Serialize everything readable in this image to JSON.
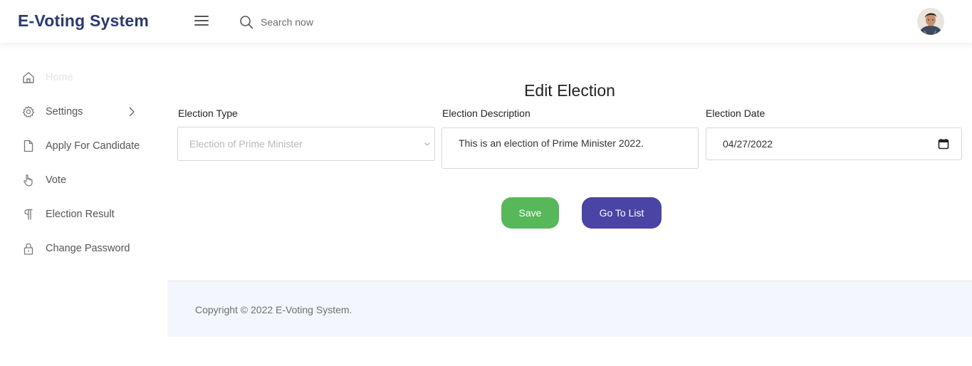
{
  "header": {
    "brand": "E-Voting System",
    "search_placeholder": "Search now"
  },
  "sidebar": {
    "items": [
      {
        "label": "Home",
        "icon": "home-icon"
      },
      {
        "label": "Settings",
        "icon": "gear-icon"
      },
      {
        "label": "Apply For Candidate",
        "icon": "file-icon"
      },
      {
        "label": "Vote",
        "icon": "hand-pointer-icon"
      },
      {
        "label": "Election Result",
        "icon": "paragraph-icon"
      },
      {
        "label": "Change Password",
        "icon": "lock-icon"
      }
    ]
  },
  "form": {
    "title": "Edit Election",
    "election_type_label": "Election Type",
    "election_type_value": "Election of Prime Minister",
    "description_label": "Election Description",
    "description_value": "This is an election of Prime Minister 2022.",
    "date_label": "Election Date",
    "date_value": "04/27/2022",
    "save_label": "Save",
    "list_label": "Go To List"
  },
  "footer": {
    "copyright": "Copyright © 2022 E-Voting System."
  },
  "colors": {
    "brand": "#2a3a6e",
    "save": "#57b85a",
    "go_to_list": "#4a44a4",
    "footer_bg": "#f3f6fc"
  }
}
